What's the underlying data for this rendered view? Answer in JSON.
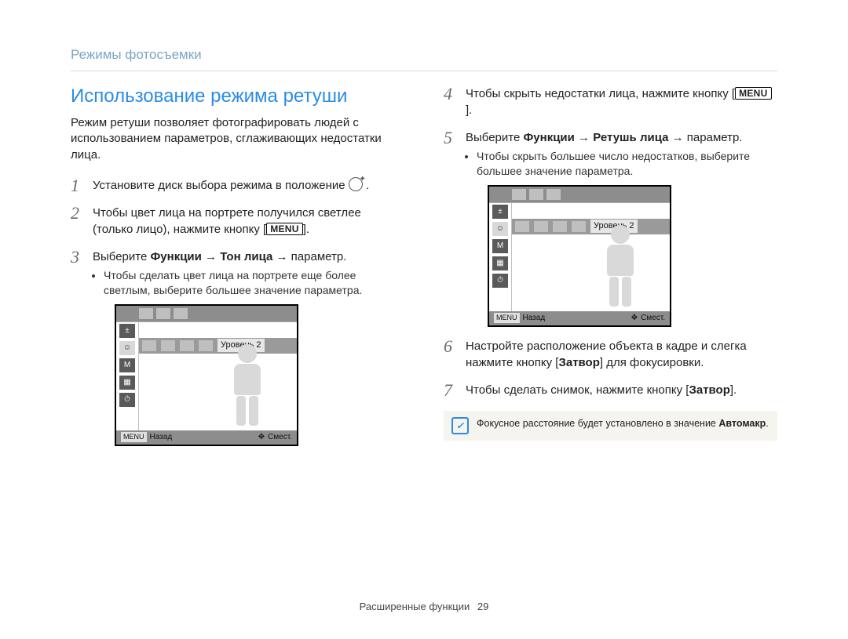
{
  "breadcrumb": "Режимы фотосъемки",
  "section_title": "Использование режима ретуши",
  "intro": "Режим ретуши позволяет фотографировать людей с использованием параметров, сглаживающих недостатки лица.",
  "left_steps": {
    "s1": {
      "num": "1",
      "text": "Установите диск выбора режима в положение "
    },
    "s2": {
      "num": "2",
      "text_a": "Чтобы цвет лица на портрете получился светлее (только лицо), нажмите кнопку ",
      "menu": "MENU",
      "text_b": "."
    },
    "s3": {
      "num": "3",
      "text_a": "Выберите ",
      "bold1": "Функции",
      "arrow1": " → ",
      "bold2": "Тон лица",
      "arrow2": " → параметр.",
      "sub": "Чтобы сделать цвет лица на портрете еще более светлым, выберите большее значение параметра."
    }
  },
  "right_steps": {
    "s4": {
      "num": "4",
      "text_a": "Чтобы скрыть недостатки лица, нажмите кнопку ",
      "menu": "MENU",
      "text_b": "."
    },
    "s5": {
      "num": "5",
      "text_a": "Выберите ",
      "bold1": "Функции",
      "arrow1": " → ",
      "bold2": "Ретушь лица",
      "arrow2": " → параметр.",
      "sub": "Чтобы скрыть большее число недостатков, выберите большее значение параметра."
    },
    "s6": {
      "num": "6",
      "text_a": "Настройте расположение объекта в кадре и слегка нажмите кнопку [",
      "bold": "Затвор",
      "text_b": "] для фокусировки."
    },
    "s7": {
      "num": "7",
      "text_a": "Чтобы сделать снимок, нажмите кнопку [",
      "bold": "Затвор",
      "text_b": "]."
    }
  },
  "cam": {
    "level_label": "Уровень 2",
    "menu_tag": "MENU",
    "back_label": "Назад",
    "move_label": "Смест."
  },
  "note": {
    "text_a": "Фокусное расстояние будет установлено в значение ",
    "bold": "Автомакр",
    "text_b": "."
  },
  "footer": {
    "section": "Расширенные функции",
    "page": "29"
  }
}
